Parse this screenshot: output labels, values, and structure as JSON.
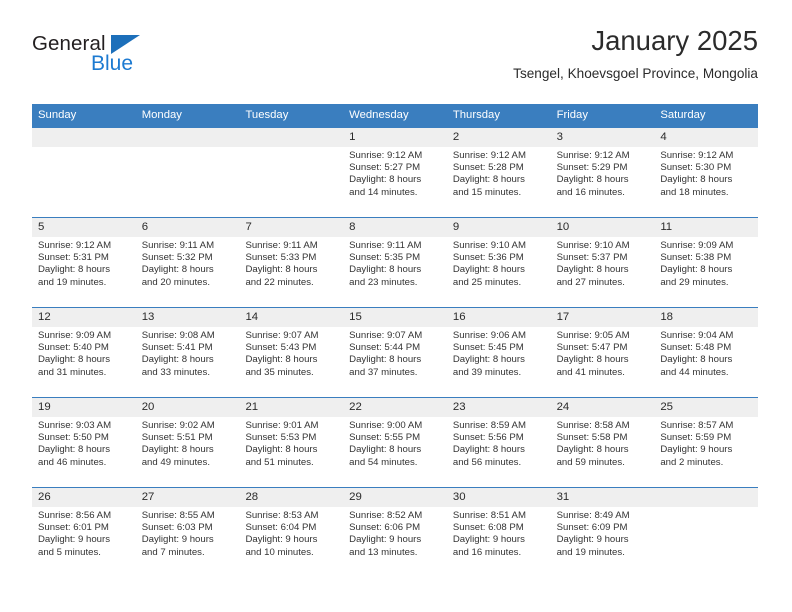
{
  "brand": {
    "name_dark": "General",
    "name_blue": "Blue",
    "triangle_color": "#1c6fba",
    "blue_color": "#1c7ad1"
  },
  "header": {
    "title": "January 2025",
    "subtitle": "Tsengel, Khoevsgoel Province, Mongolia"
  },
  "colors": {
    "header_blue": "#3a7ebf",
    "day_band_gray": "#efefef",
    "text": "#2b2b2b"
  },
  "weekdays": [
    "Sunday",
    "Monday",
    "Tuesday",
    "Wednesday",
    "Thursday",
    "Friday",
    "Saturday"
  ],
  "weeks": [
    [
      {
        "day": "",
        "sunrise": "",
        "sunset": "",
        "daylight_line1": "",
        "daylight_line2": ""
      },
      {
        "day": "",
        "sunrise": "",
        "sunset": "",
        "daylight_line1": "",
        "daylight_line2": ""
      },
      {
        "day": "",
        "sunrise": "",
        "sunset": "",
        "daylight_line1": "",
        "daylight_line2": ""
      },
      {
        "day": "1",
        "sunrise": "Sunrise: 9:12 AM",
        "sunset": "Sunset: 5:27 PM",
        "daylight_line1": "Daylight: 8 hours",
        "daylight_line2": "and 14 minutes."
      },
      {
        "day": "2",
        "sunrise": "Sunrise: 9:12 AM",
        "sunset": "Sunset: 5:28 PM",
        "daylight_line1": "Daylight: 8 hours",
        "daylight_line2": "and 15 minutes."
      },
      {
        "day": "3",
        "sunrise": "Sunrise: 9:12 AM",
        "sunset": "Sunset: 5:29 PM",
        "daylight_line1": "Daylight: 8 hours",
        "daylight_line2": "and 16 minutes."
      },
      {
        "day": "4",
        "sunrise": "Sunrise: 9:12 AM",
        "sunset": "Sunset: 5:30 PM",
        "daylight_line1": "Daylight: 8 hours",
        "daylight_line2": "and 18 minutes."
      }
    ],
    [
      {
        "day": "5",
        "sunrise": "Sunrise: 9:12 AM",
        "sunset": "Sunset: 5:31 PM",
        "daylight_line1": "Daylight: 8 hours",
        "daylight_line2": "and 19 minutes."
      },
      {
        "day": "6",
        "sunrise": "Sunrise: 9:11 AM",
        "sunset": "Sunset: 5:32 PM",
        "daylight_line1": "Daylight: 8 hours",
        "daylight_line2": "and 20 minutes."
      },
      {
        "day": "7",
        "sunrise": "Sunrise: 9:11 AM",
        "sunset": "Sunset: 5:33 PM",
        "daylight_line1": "Daylight: 8 hours",
        "daylight_line2": "and 22 minutes."
      },
      {
        "day": "8",
        "sunrise": "Sunrise: 9:11 AM",
        "sunset": "Sunset: 5:35 PM",
        "daylight_line1": "Daylight: 8 hours",
        "daylight_line2": "and 23 minutes."
      },
      {
        "day": "9",
        "sunrise": "Sunrise: 9:10 AM",
        "sunset": "Sunset: 5:36 PM",
        "daylight_line1": "Daylight: 8 hours",
        "daylight_line2": "and 25 minutes."
      },
      {
        "day": "10",
        "sunrise": "Sunrise: 9:10 AM",
        "sunset": "Sunset: 5:37 PM",
        "daylight_line1": "Daylight: 8 hours",
        "daylight_line2": "and 27 minutes."
      },
      {
        "day": "11",
        "sunrise": "Sunrise: 9:09 AM",
        "sunset": "Sunset: 5:38 PM",
        "daylight_line1": "Daylight: 8 hours",
        "daylight_line2": "and 29 minutes."
      }
    ],
    [
      {
        "day": "12",
        "sunrise": "Sunrise: 9:09 AM",
        "sunset": "Sunset: 5:40 PM",
        "daylight_line1": "Daylight: 8 hours",
        "daylight_line2": "and 31 minutes."
      },
      {
        "day": "13",
        "sunrise": "Sunrise: 9:08 AM",
        "sunset": "Sunset: 5:41 PM",
        "daylight_line1": "Daylight: 8 hours",
        "daylight_line2": "and 33 minutes."
      },
      {
        "day": "14",
        "sunrise": "Sunrise: 9:07 AM",
        "sunset": "Sunset: 5:43 PM",
        "daylight_line1": "Daylight: 8 hours",
        "daylight_line2": "and 35 minutes."
      },
      {
        "day": "15",
        "sunrise": "Sunrise: 9:07 AM",
        "sunset": "Sunset: 5:44 PM",
        "daylight_line1": "Daylight: 8 hours",
        "daylight_line2": "and 37 minutes."
      },
      {
        "day": "16",
        "sunrise": "Sunrise: 9:06 AM",
        "sunset": "Sunset: 5:45 PM",
        "daylight_line1": "Daylight: 8 hours",
        "daylight_line2": "and 39 minutes."
      },
      {
        "day": "17",
        "sunrise": "Sunrise: 9:05 AM",
        "sunset": "Sunset: 5:47 PM",
        "daylight_line1": "Daylight: 8 hours",
        "daylight_line2": "and 41 minutes."
      },
      {
        "day": "18",
        "sunrise": "Sunrise: 9:04 AM",
        "sunset": "Sunset: 5:48 PM",
        "daylight_line1": "Daylight: 8 hours",
        "daylight_line2": "and 44 minutes."
      }
    ],
    [
      {
        "day": "19",
        "sunrise": "Sunrise: 9:03 AM",
        "sunset": "Sunset: 5:50 PM",
        "daylight_line1": "Daylight: 8 hours",
        "daylight_line2": "and 46 minutes."
      },
      {
        "day": "20",
        "sunrise": "Sunrise: 9:02 AM",
        "sunset": "Sunset: 5:51 PM",
        "daylight_line1": "Daylight: 8 hours",
        "daylight_line2": "and 49 minutes."
      },
      {
        "day": "21",
        "sunrise": "Sunrise: 9:01 AM",
        "sunset": "Sunset: 5:53 PM",
        "daylight_line1": "Daylight: 8 hours",
        "daylight_line2": "and 51 minutes."
      },
      {
        "day": "22",
        "sunrise": "Sunrise: 9:00 AM",
        "sunset": "Sunset: 5:55 PM",
        "daylight_line1": "Daylight: 8 hours",
        "daylight_line2": "and 54 minutes."
      },
      {
        "day": "23",
        "sunrise": "Sunrise: 8:59 AM",
        "sunset": "Sunset: 5:56 PM",
        "daylight_line1": "Daylight: 8 hours",
        "daylight_line2": "and 56 minutes."
      },
      {
        "day": "24",
        "sunrise": "Sunrise: 8:58 AM",
        "sunset": "Sunset: 5:58 PM",
        "daylight_line1": "Daylight: 8 hours",
        "daylight_line2": "and 59 minutes."
      },
      {
        "day": "25",
        "sunrise": "Sunrise: 8:57 AM",
        "sunset": "Sunset: 5:59 PM",
        "daylight_line1": "Daylight: 9 hours",
        "daylight_line2": "and 2 minutes."
      }
    ],
    [
      {
        "day": "26",
        "sunrise": "Sunrise: 8:56 AM",
        "sunset": "Sunset: 6:01 PM",
        "daylight_line1": "Daylight: 9 hours",
        "daylight_line2": "and 5 minutes."
      },
      {
        "day": "27",
        "sunrise": "Sunrise: 8:55 AM",
        "sunset": "Sunset: 6:03 PM",
        "daylight_line1": "Daylight: 9 hours",
        "daylight_line2": "and 7 minutes."
      },
      {
        "day": "28",
        "sunrise": "Sunrise: 8:53 AM",
        "sunset": "Sunset: 6:04 PM",
        "daylight_line1": "Daylight: 9 hours",
        "daylight_line2": "and 10 minutes."
      },
      {
        "day": "29",
        "sunrise": "Sunrise: 8:52 AM",
        "sunset": "Sunset: 6:06 PM",
        "daylight_line1": "Daylight: 9 hours",
        "daylight_line2": "and 13 minutes."
      },
      {
        "day": "30",
        "sunrise": "Sunrise: 8:51 AM",
        "sunset": "Sunset: 6:08 PM",
        "daylight_line1": "Daylight: 9 hours",
        "daylight_line2": "and 16 minutes."
      },
      {
        "day": "31",
        "sunrise": "Sunrise: 8:49 AM",
        "sunset": "Sunset: 6:09 PM",
        "daylight_line1": "Daylight: 9 hours",
        "daylight_line2": "and 19 minutes."
      },
      {
        "day": "",
        "sunrise": "",
        "sunset": "",
        "daylight_line1": "",
        "daylight_line2": ""
      }
    ]
  ]
}
